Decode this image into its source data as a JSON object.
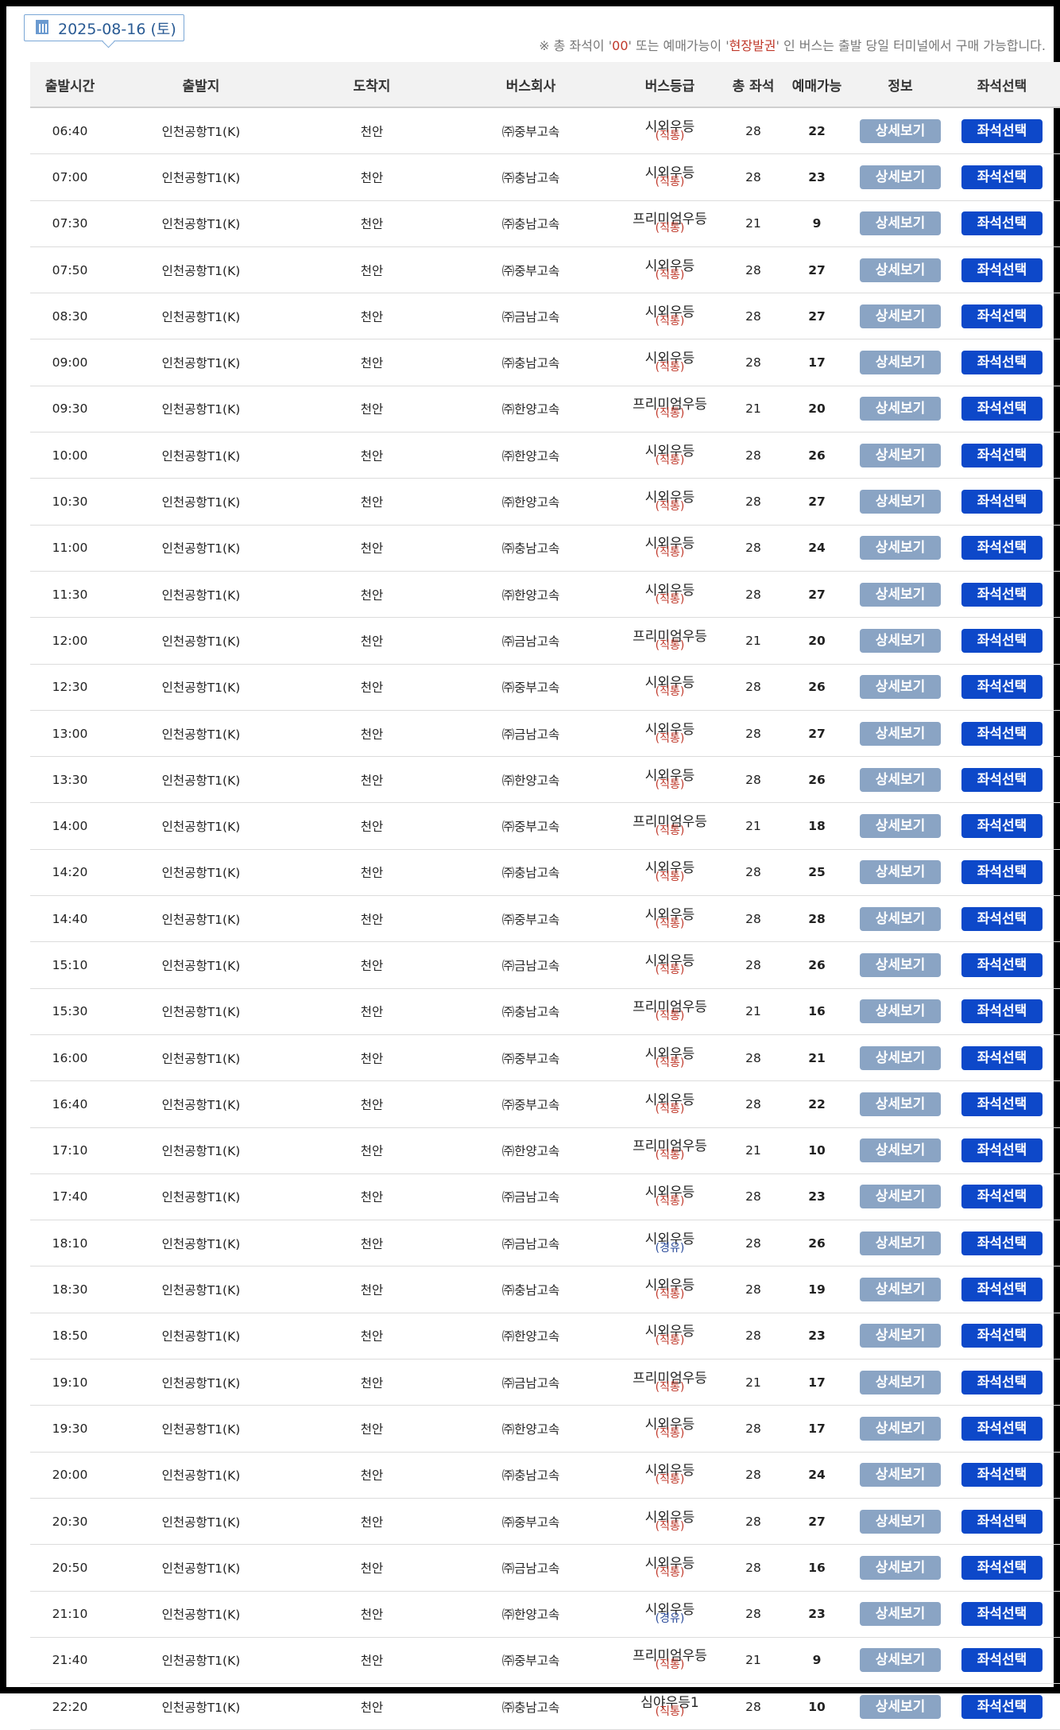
{
  "header": {
    "date": "2025-08-16 (토)",
    "notice_prefix": "※ 총 좌석이 '",
    "notice_zero": "00",
    "notice_mid": "' 또는 예매가능이 '",
    "notice_onsite": "현장발권",
    "notice_suffix": "' 인 버스는 출발 당일 터미널에서 구매 가능합니다."
  },
  "columns": [
    "출발시간",
    "출발지",
    "도착지",
    "버스회사",
    "버스등급",
    "총 좌석",
    "예매가능",
    "정보",
    "좌석선택"
  ],
  "buttons": {
    "detail": "상세보기",
    "select": "좌석선택"
  },
  "rows": [
    {
      "time": "06:40",
      "from": "인천공항T1(K)",
      "to": "천안",
      "company": "㈜중부고속",
      "grade": "시외우등",
      "grade_sub": "(직통)",
      "total": "28",
      "avail": "22"
    },
    {
      "time": "07:00",
      "from": "인천공항T1(K)",
      "to": "천안",
      "company": "㈜충남고속",
      "grade": "시외우등",
      "grade_sub": "(직통)",
      "total": "28",
      "avail": "23"
    },
    {
      "time": "07:30",
      "from": "인천공항T1(K)",
      "to": "천안",
      "company": "㈜충남고속",
      "grade": "프리미엄우등",
      "grade_sub": "(직통)",
      "total": "21",
      "avail": "9"
    },
    {
      "time": "07:50",
      "from": "인천공항T1(K)",
      "to": "천안",
      "company": "㈜중부고속",
      "grade": "시외우등",
      "grade_sub": "(직통)",
      "total": "28",
      "avail": "27"
    },
    {
      "time": "08:30",
      "from": "인천공항T1(K)",
      "to": "천안",
      "company": "㈜금남고속",
      "grade": "시외우등",
      "grade_sub": "(직통)",
      "total": "28",
      "avail": "27"
    },
    {
      "time": "09:00",
      "from": "인천공항T1(K)",
      "to": "천안",
      "company": "㈜충남고속",
      "grade": "시외우등",
      "grade_sub": "(직통)",
      "total": "28",
      "avail": "17"
    },
    {
      "time": "09:30",
      "from": "인천공항T1(K)",
      "to": "천안",
      "company": "㈜한양고속",
      "grade": "프리미엄우등",
      "grade_sub": "(직통)",
      "total": "21",
      "avail": "20"
    },
    {
      "time": "10:00",
      "from": "인천공항T1(K)",
      "to": "천안",
      "company": "㈜한양고속",
      "grade": "시외우등",
      "grade_sub": "(직통)",
      "total": "28",
      "avail": "26"
    },
    {
      "time": "10:30",
      "from": "인천공항T1(K)",
      "to": "천안",
      "company": "㈜한양고속",
      "grade": "시외우등",
      "grade_sub": "(직통)",
      "total": "28",
      "avail": "27"
    },
    {
      "time": "11:00",
      "from": "인천공항T1(K)",
      "to": "천안",
      "company": "㈜충남고속",
      "grade": "시외우등",
      "grade_sub": "(직통)",
      "total": "28",
      "avail": "24"
    },
    {
      "time": "11:30",
      "from": "인천공항T1(K)",
      "to": "천안",
      "company": "㈜한양고속",
      "grade": "시외우등",
      "grade_sub": "(직통)",
      "total": "28",
      "avail": "27"
    },
    {
      "time": "12:00",
      "from": "인천공항T1(K)",
      "to": "천안",
      "company": "㈜금남고속",
      "grade": "프리미엄우등",
      "grade_sub": "(직통)",
      "total": "21",
      "avail": "20"
    },
    {
      "time": "12:30",
      "from": "인천공항T1(K)",
      "to": "천안",
      "company": "㈜중부고속",
      "grade": "시외우등",
      "grade_sub": "(직통)",
      "total": "28",
      "avail": "26"
    },
    {
      "time": "13:00",
      "from": "인천공항T1(K)",
      "to": "천안",
      "company": "㈜금남고속",
      "grade": "시외우등",
      "grade_sub": "(직통)",
      "total": "28",
      "avail": "27"
    },
    {
      "time": "13:30",
      "from": "인천공항T1(K)",
      "to": "천안",
      "company": "㈜한양고속",
      "grade": "시외우등",
      "grade_sub": "(직통)",
      "total": "28",
      "avail": "26"
    },
    {
      "time": "14:00",
      "from": "인천공항T1(K)",
      "to": "천안",
      "company": "㈜중부고속",
      "grade": "프리미엄우등",
      "grade_sub": "(직통)",
      "total": "21",
      "avail": "18"
    },
    {
      "time": "14:20",
      "from": "인천공항T1(K)",
      "to": "천안",
      "company": "㈜충남고속",
      "grade": "시외우등",
      "grade_sub": "(직통)",
      "total": "28",
      "avail": "25"
    },
    {
      "time": "14:40",
      "from": "인천공항T1(K)",
      "to": "천안",
      "company": "㈜중부고속",
      "grade": "시외우등",
      "grade_sub": "(직통)",
      "total": "28",
      "avail": "28"
    },
    {
      "time": "15:10",
      "from": "인천공항T1(K)",
      "to": "천안",
      "company": "㈜금남고속",
      "grade": "시외우등",
      "grade_sub": "(직통)",
      "total": "28",
      "avail": "26"
    },
    {
      "time": "15:30",
      "from": "인천공항T1(K)",
      "to": "천안",
      "company": "㈜충남고속",
      "grade": "프리미엄우등",
      "grade_sub": "(직통)",
      "total": "21",
      "avail": "16"
    },
    {
      "time": "16:00",
      "from": "인천공항T1(K)",
      "to": "천안",
      "company": "㈜중부고속",
      "grade": "시외우등",
      "grade_sub": "(직통)",
      "total": "28",
      "avail": "21"
    },
    {
      "time": "16:40",
      "from": "인천공항T1(K)",
      "to": "천안",
      "company": "㈜중부고속",
      "grade": "시외우등",
      "grade_sub": "(직통)",
      "total": "28",
      "avail": "22"
    },
    {
      "time": "17:10",
      "from": "인천공항T1(K)",
      "to": "천안",
      "company": "㈜한양고속",
      "grade": "프리미엄우등",
      "grade_sub": "(직통)",
      "total": "21",
      "avail": "10"
    },
    {
      "time": "17:40",
      "from": "인천공항T1(K)",
      "to": "천안",
      "company": "㈜금남고속",
      "grade": "시외우등",
      "grade_sub": "(직통)",
      "total": "28",
      "avail": "23"
    },
    {
      "time": "18:10",
      "from": "인천공항T1(K)",
      "to": "천안",
      "company": "㈜금남고속",
      "grade": "시외우등",
      "grade_sub": "(경유)",
      "total": "28",
      "avail": "26"
    },
    {
      "time": "18:30",
      "from": "인천공항T1(K)",
      "to": "천안",
      "company": "㈜충남고속",
      "grade": "시외우등",
      "grade_sub": "(직통)",
      "total": "28",
      "avail": "19"
    },
    {
      "time": "18:50",
      "from": "인천공항T1(K)",
      "to": "천안",
      "company": "㈜한양고속",
      "grade": "시외우등",
      "grade_sub": "(직통)",
      "total": "28",
      "avail": "23"
    },
    {
      "time": "19:10",
      "from": "인천공항T1(K)",
      "to": "천안",
      "company": "㈜금남고속",
      "grade": "프리미엄우등",
      "grade_sub": "(직통)",
      "total": "21",
      "avail": "17"
    },
    {
      "time": "19:30",
      "from": "인천공항T1(K)",
      "to": "천안",
      "company": "㈜한양고속",
      "grade": "시외우등",
      "grade_sub": "(직통)",
      "total": "28",
      "avail": "17"
    },
    {
      "time": "20:00",
      "from": "인천공항T1(K)",
      "to": "천안",
      "company": "㈜충남고속",
      "grade": "시외우등",
      "grade_sub": "(직통)",
      "total": "28",
      "avail": "24"
    },
    {
      "time": "20:30",
      "from": "인천공항T1(K)",
      "to": "천안",
      "company": "㈜중부고속",
      "grade": "시외우등",
      "grade_sub": "(직통)",
      "total": "28",
      "avail": "27"
    },
    {
      "time": "20:50",
      "from": "인천공항T1(K)",
      "to": "천안",
      "company": "㈜금남고속",
      "grade": "시외우등",
      "grade_sub": "(직통)",
      "total": "28",
      "avail": "16"
    },
    {
      "time": "21:10",
      "from": "인천공항T1(K)",
      "to": "천안",
      "company": "㈜한양고속",
      "grade": "시외우등",
      "grade_sub": "(경유)",
      "total": "28",
      "avail": "23"
    },
    {
      "time": "21:40",
      "from": "인천공항T1(K)",
      "to": "천안",
      "company": "㈜중부고속",
      "grade": "프리미엄우등",
      "grade_sub": "(직통)",
      "total": "21",
      "avail": "9"
    },
    {
      "time": "22:20",
      "from": "인천공항T1(K)",
      "to": "천안",
      "company": "㈜충남고속",
      "grade": "심야우등1",
      "grade_sub": "(직통)",
      "total": "28",
      "avail": "10"
    }
  ],
  "colors": {
    "detail_button": "#8aa4c4",
    "select_button": "#0d48c9",
    "direct_text": "#c0392b",
    "via_text": "#2a4a9a"
  }
}
